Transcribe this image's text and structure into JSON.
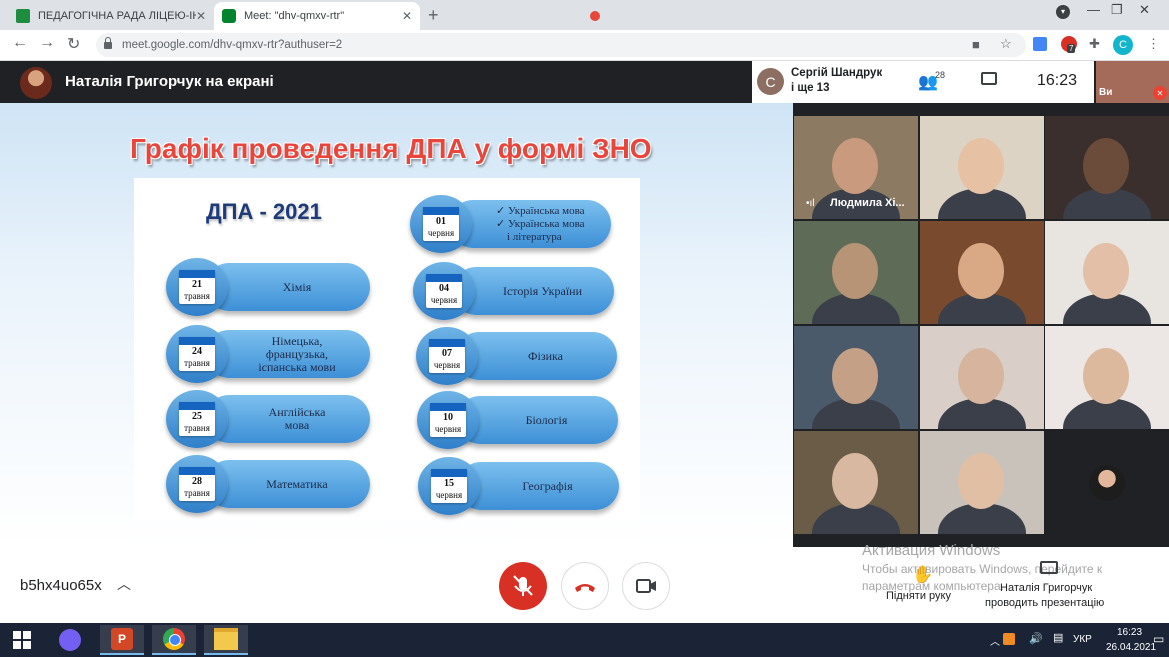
{
  "browser": {
    "tabs": [
      {
        "title": "ПЕДАГОГІЧНА РАДА ЛІЦЕЮ-ІНТ",
        "favicon": "google-classroom-icon",
        "color": "#1e8e3e"
      },
      {
        "title": "Meet: \"dhv-qmxv-rtr\"",
        "favicon": "google-meet-icon",
        "color": "#00832d",
        "recording": true
      }
    ],
    "new_tab": "+",
    "url": "meet.google.com/dhv-qmxv-rtr?authuser=2",
    "profile_initial": "C",
    "extension_badge": "7"
  },
  "meet_header": {
    "presenting_label": "Наталія Григорчук на екрані",
    "participant_initial": "C",
    "participant_line1": "Сергій Шандрук",
    "participant_line2": "і ще 13",
    "people_count": "28",
    "time": "16:23",
    "self_label": "Ви"
  },
  "slide": {
    "title": "Графік проведення ДПА у формі ЗНО",
    "subtitle": "ДПА - 2021",
    "left_exams": [
      {
        "day": "21",
        "month": "травня",
        "subject": [
          "Хімія"
        ]
      },
      {
        "day": "24",
        "month": "травня",
        "subject": [
          "Німецька,",
          "французька,",
          "іспанська мови"
        ]
      },
      {
        "day": "25",
        "month": "травня",
        "subject": [
          "Англійська",
          "мова"
        ]
      },
      {
        "day": "28",
        "month": "травня",
        "subject": [
          "Математика"
        ]
      }
    ],
    "right_exams": [
      {
        "day": "01",
        "month": "червня",
        "subject": [
          "✓ Українська мова",
          "✓ Українська мова",
          "і література"
        ]
      },
      {
        "day": "04",
        "month": "червня",
        "subject": [
          "Історія України"
        ]
      },
      {
        "day": "07",
        "month": "червня",
        "subject": [
          "Фізика"
        ]
      },
      {
        "day": "10",
        "month": "червня",
        "subject": [
          "Біологія"
        ]
      },
      {
        "day": "15",
        "month": "червня",
        "subject": [
          "Географія"
        ]
      }
    ]
  },
  "participants": {
    "featured_name": "Людмила Хі..."
  },
  "bottom_bar": {
    "meeting_code": "b5hx4uo65x",
    "activation_title": "Активация Windows",
    "activation_line1": "Чтобы активировать Windows, перейдите к",
    "activation_line2": "параметрам компьютера.",
    "raise_hand_label": "Підняти руку",
    "presenter_line1": "Наталія Григорчук",
    "presenter_line2": "проводить презентацію"
  },
  "taskbar": {
    "apps": [
      "windows-start-icon",
      "viber-icon",
      "powerpoint-icon",
      "chrome-icon",
      "file-explorer-icon"
    ],
    "language": "УКР",
    "time": "16:23",
    "date": "26.04.2021"
  }
}
